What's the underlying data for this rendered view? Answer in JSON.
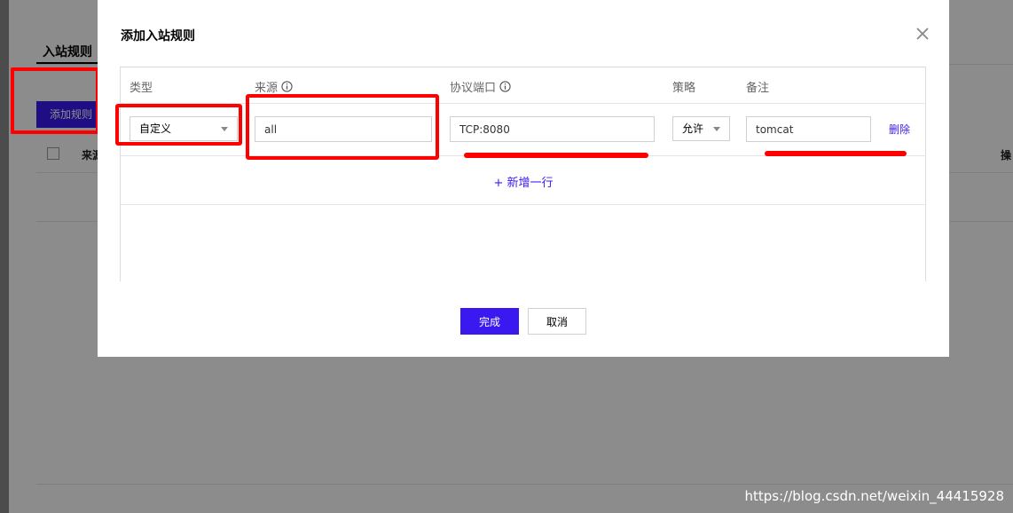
{
  "background": {
    "tab_label": "入站规则",
    "add_button_label": "添加规则",
    "col_source": "来源",
    "col_edge": "操"
  },
  "modal": {
    "title": "添加入站规则",
    "headers": {
      "type": "类型",
      "source": "来源",
      "protocol_port": "协议端口",
      "policy": "策略",
      "remark": "备注"
    },
    "row": {
      "type_value": "自定义",
      "source_value": "all",
      "protocol_port_value": "TCP:8080",
      "policy_value": "允许",
      "remark_value": "tomcat",
      "delete_label": "删除"
    },
    "add_row_label": "+ 新增一行",
    "done_label": "完成",
    "cancel_label": "取消"
  },
  "watermark": "https://blog.csdn.net/weixin_44415928",
  "colors": {
    "accent": "#3a19f0",
    "annotation": "#ff0000"
  }
}
